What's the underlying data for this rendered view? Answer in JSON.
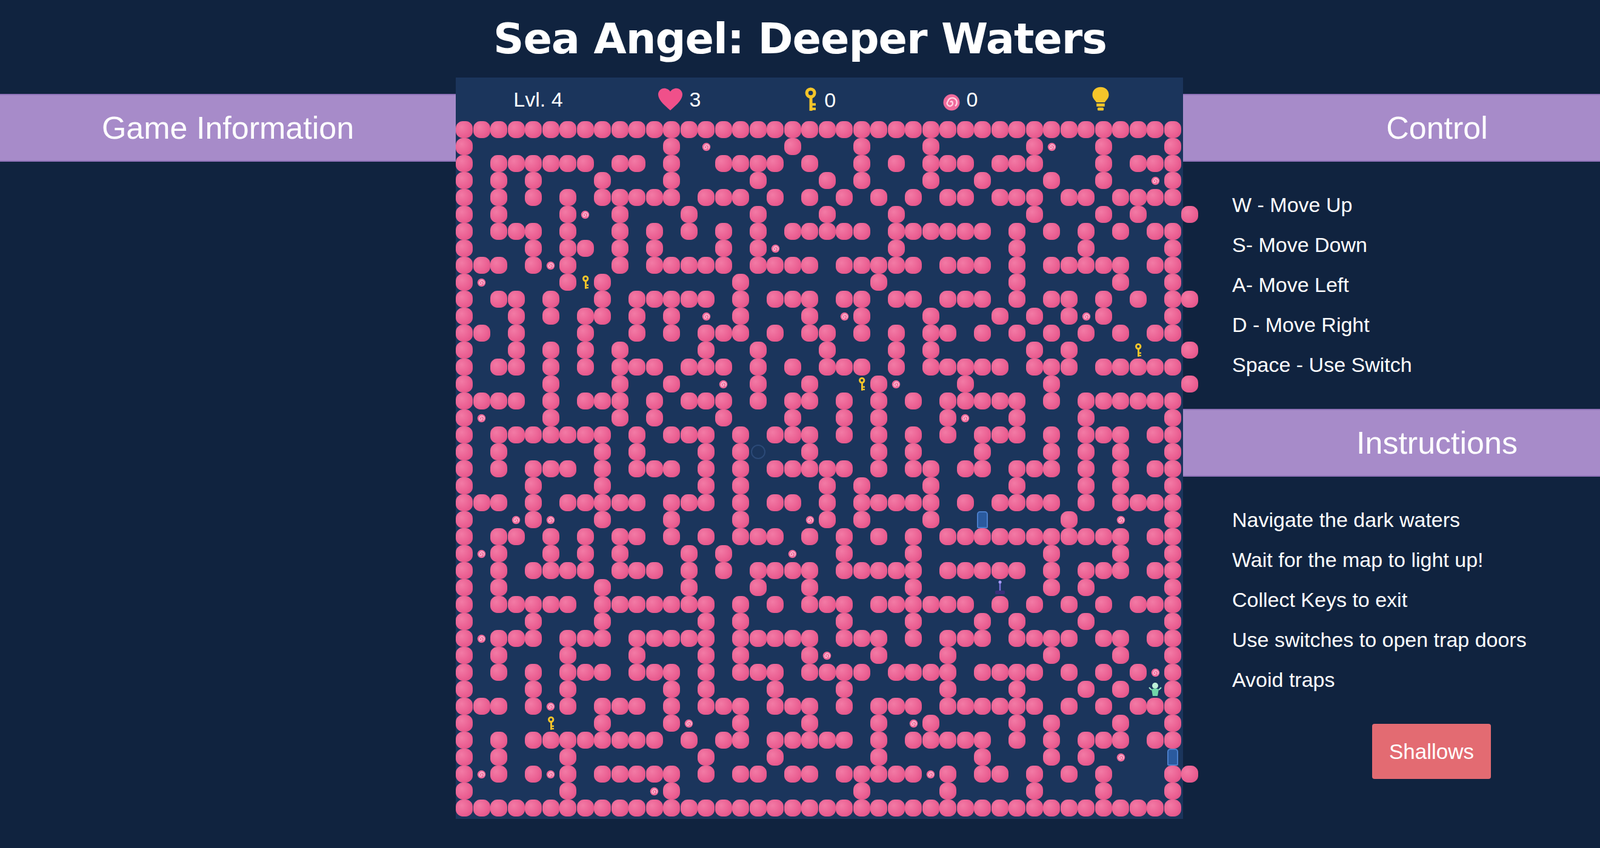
{
  "title": "Sea Angel: Deeper Waters",
  "hud": {
    "level": "Lvl. 4",
    "lives": "3",
    "keys": "0",
    "shells": "0"
  },
  "panels": {
    "left": {
      "title": "Game Information"
    },
    "controls": {
      "title": "Control",
      "items": [
        "W - Move Up",
        "S- Move Down",
        "A- Move Left",
        "D - Move Right",
        "Space - Use Switch"
      ]
    },
    "instructions": {
      "title": "Instructions",
      "items": [
        "Navigate the dark waters",
        "Wait for the map to light up!",
        "Collect Keys to exit",
        "Use switches to open trap doors",
        "Avoid traps"
      ]
    }
  },
  "button": "Shallows",
  "maze": {
    "legend": {
      "#": "wall",
      ".": "path",
      "s": "shell",
      "k": "key",
      "d": "door",
      "w": "switch",
      "p": "player",
      "o": "trap"
    },
    "rows": [
      "##########################################",
      "#...........#.s....#...#...#.....#s..#...#",
      "#.######.##.#..####.#..#.#.###.###...#.###",
      "#.#.#...#...#....#...#.#...#..#...#..#..s#",
      "#.#.#.#.#####.###.#.#.#.#.#.##.###.##.####",
      "#.#...#s.#...#...#...#...#.......#...#.#..#",
      "#.###.#..#.#.#.#.#.#####.######.#.#.#.#.##",
      "#...#.##.#.#...#.#s......#......#...#....#",
      "###.#s#..#.#####.####.#####.###.#.#####.##",
      "#s....#k#.......#.......#.......#.....#..#",
      "#.##.#..#.#####.#.###.##.##.###.#.##.#.#.##",
      "#..#.#.##.#.#.s.#...#.s#...#...#.#.#s#...#",
      "##.#...#..#.#.###.#.##.#.#.##.#.#.#.#.#.##",
      "#..#.#.#.#....#..#...#...#.#.....#.#...k..#",
      "#.##.#.#.###.###.#.#.###.#.#####.###.#####",
      "#....#...#..#..s.#..#..k#s...#....#.......#",
      "####.#.###.#.###.#.##.#.#.#.#####.#.######",
      "#s...#...#.#...#...#..#.#...#s..#...#....#",
      "#.#######.#.###.#.###.#.#.#.#.###.#.###.##",
      "#.#.....#.#...#.#o..#...#.#...#...#.#.#..#",
      "#.#.###.#.###.#.#.#####.#.##.##.###.#.#.##",
      "#...#...#.....#.#....#.#...#....#...#.#..#",
      "###.#.#####.###.#.##.#.#####.#.####.#.####",
      "#..s#s..#...#...#...s#.#...#..d....#..s..#",
      "#.##.#.#.##.#.#.###.#.#.#.#.###########.##",
      "#s#..#.#.#...#.#...s..#...#.......#...#..#",
      "#.#.####.###.#.#.####.#####.#####.#.###.##",
      "#.#.....#....#...#..#.....#....w..#.#....#",
      "#.#####.#######.#.#.###.######.#.#.#.#.###",
      "#...#...#.....#.#.....#...#...#.#...#....#",
      "#s###.###.#####.#####.###.#.###.####.##.##",
      "#.#...#...#...#.#...#s..#...#.....#...#..#",
      "#.#.#.###.###.#.###.####.####.####.#.#.#s#",
      "#...#.#.....#.#...#...#.....#...#...#.#.p#",
      "###.#s#.###.#.###.###.#.###.######.#.#.###",
      "#....k..#...#s..#...#...#.s#....#.#...#..#",
      "#.#.########.#.##.#####.#.#####.#.#.###.##",
      "#.#...#.......#...#.....#.....#...#.#.s..d",
      "#s#.#s#.#####.#.##.##.#####s#.##.#.#.#...##",
      "#.....#....s#..........#....#....#...#...#",
      "##########################################"
    ]
  }
}
